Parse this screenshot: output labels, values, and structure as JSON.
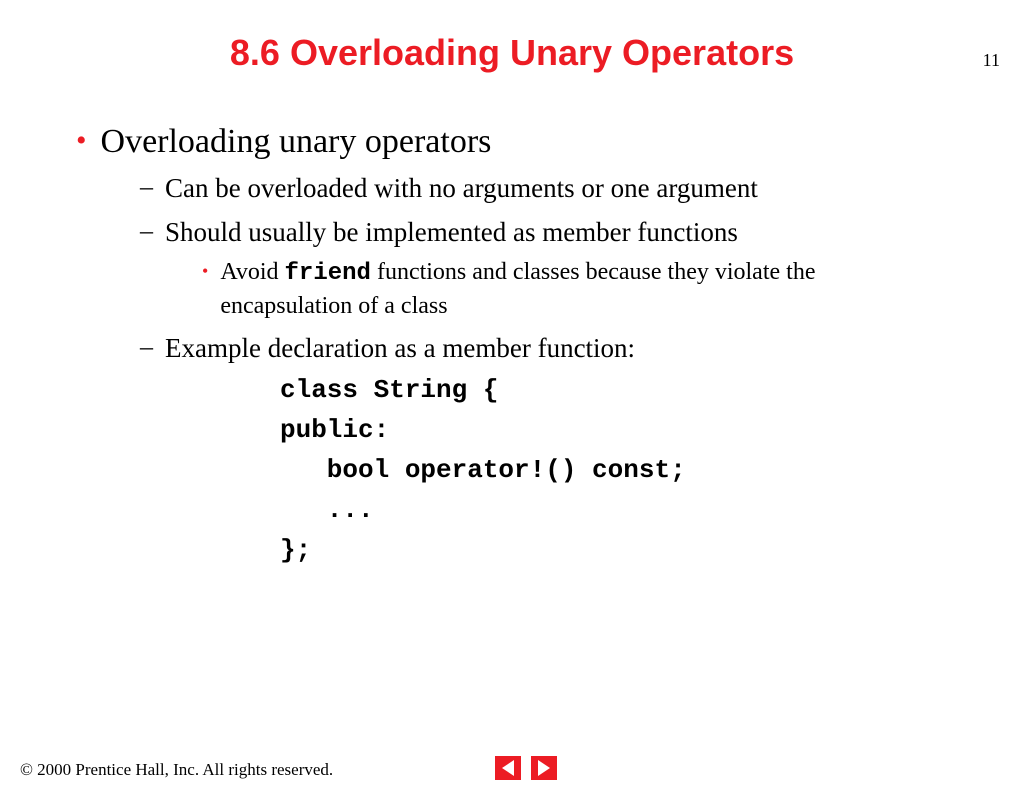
{
  "pageNumber": "11",
  "title": "8.6  Overloading Unary Operators",
  "bullets": {
    "l1": "Overloading unary operators",
    "l2a": "Can be overloaded with no arguments or one argument",
    "l2b": "Should usually be implemented as member functions",
    "l3a_pre": "Avoid ",
    "l3a_code": "friend",
    "l3a_post": " functions and classes because they violate the encapsulation of a class",
    "l2c": "Example declaration as a member function:"
  },
  "code": "class String {\npublic:\n   bool operator!() const;\n   ...\n};",
  "copyright": "© 2000 Prentice Hall, Inc. All rights reserved."
}
